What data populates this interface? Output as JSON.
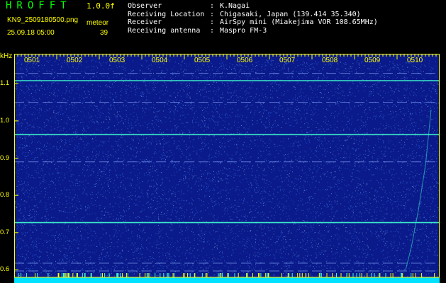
{
  "header": {
    "app_title": "HROFFT",
    "version": "1.0.0f",
    "filename": "KN9_2509180500.png",
    "meteor_label": "meteor",
    "datetime": "25.09.18 05:00",
    "meteor_count": "39"
  },
  "info": [
    {
      "key": "Observer",
      "value": "K.Nagai"
    },
    {
      "key": "Receiving Location",
      "value": "Chigasaki, Japan (139.414 35.340)"
    },
    {
      "key": "Receiver",
      "value": "AirSpy mini (Miakejima VOR 108.65MHz)"
    },
    {
      "key": "Receiving antenna",
      "value": "Maspro FM-3"
    }
  ],
  "colors": {
    "background": "#0a1a8a",
    "noise": "#3a7cff",
    "carrier": "#40ffd0",
    "frame": "#ffff00",
    "bottom_strip": "#00e0ff"
  },
  "chart_data": {
    "type": "heatmap",
    "ylabel": "kHz",
    "y_ticks": [
      "1.1",
      "1.0",
      "0.9",
      "0.8",
      "0.7",
      "0.6"
    ],
    "ylim": [
      0.58,
      1.165
    ],
    "x_ticks": [
      "0501",
      "0502",
      "0503",
      "0504",
      "0505",
      "0506",
      "0507",
      "0508",
      "0509",
      "0510"
    ],
    "xlim": [
      0,
      10
    ],
    "carrier_lines_khz": [
      1.108,
      0.963,
      0.727
    ],
    "faint_lines_khz": [
      1.128,
      1.05,
      0.89,
      0.618,
      0.597
    ]
  }
}
